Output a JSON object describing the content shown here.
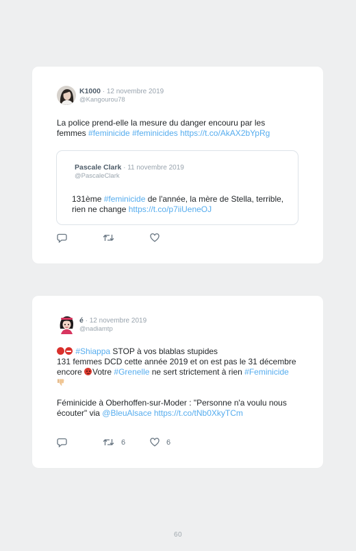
{
  "tweets": [
    {
      "name": "K1000",
      "date": " · 12 novembre 2019",
      "handle": "@Kangourou78",
      "text_plain": "La police prend-elle la mesure du danger encouru par les femmes ",
      "hashtag1": "#feminicide",
      "hashtag2": "#feminicides",
      "link": "https://t.co/AkAX2bYpRg",
      "quote": {
        "name": "Pascale Clark",
        "date": " · 11 novembre 2019",
        "handle": "@PascaleClark",
        "text_a": "131ème ",
        "hashtag": "#feminicide",
        "text_b": " de l'année, la mère de Stella, terrible, rien ne change ",
        "link": "https://t.co/p7iiUeneOJ"
      },
      "retweets": "",
      "likes": ""
    },
    {
      "name": "é",
      "date": " · 12 novembre 2019",
      "handle": "@nadiamtp",
      "hashtag_shiappa": "#Shiappa",
      "text_1": " STOP à vos blablas stupides",
      "text_2": "131 femmes DCD cette année 2019 et on est pas le 31 décembre encore ",
      "text_3": "Votre ",
      "hashtag_grenelle": "#Grenelle",
      "text_4": " ne sert strictement à rien ",
      "hashtag_feminicide": "#Feminicide",
      "text_5": "Féminicide à Oberhoffen-sur-Moder : \"Personne n'a voulu nous écouter\" via ",
      "mention": "@BleuAlsace",
      "link": " https://t.co/tNb0XkyTCm",
      "retweets": "6",
      "likes": "6"
    }
  ],
  "page_number": "60",
  "colors": {
    "link": "#55acee",
    "background": "#eeeff0",
    "card": "#ffffff",
    "icon": "#667480"
  },
  "icons": [
    "reply-icon",
    "retweet-icon",
    "like-icon",
    "red-circle-emoji",
    "no-entry-emoji",
    "angry-face-emoji",
    "thumbs-down-emoji"
  ]
}
